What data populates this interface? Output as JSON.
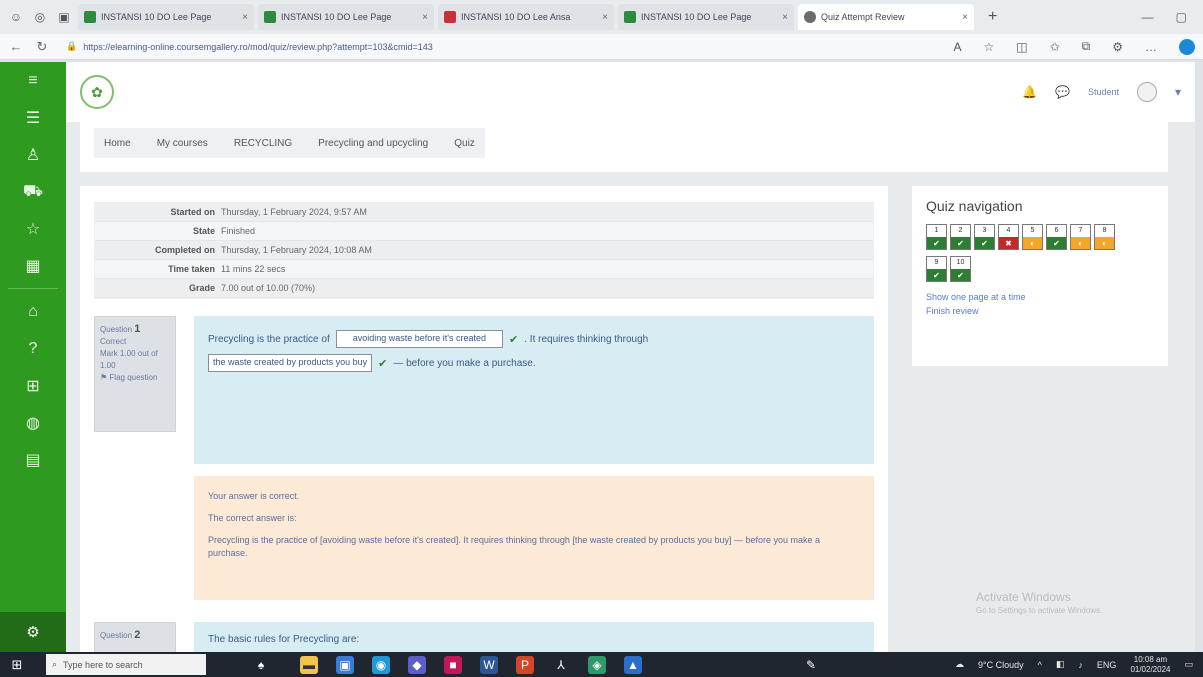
{
  "browser": {
    "tabs": [
      {
        "label": "INSTANSI 10 DO Lee Page",
        "active": false
      },
      {
        "label": "INSTANSI 10 DO Lee Page",
        "active": false
      },
      {
        "label": "INSTANSI 10 DO Lee Ansa",
        "active": false
      },
      {
        "label": "INSTANSI 10 DO Lee Page",
        "active": false
      },
      {
        "label": "Quiz Attempt Review",
        "active": true
      }
    ],
    "url": "https://elearning-online.coursemgallery.ro/mod/quiz/review.php?attempt=103&cmid=143"
  },
  "sidebar": {
    "items": [
      "menu-icon",
      "list-icon",
      "user-icon",
      "car-icon",
      "star-icon",
      "calendar-icon",
      "home-icon",
      "help-icon",
      "grid-icon",
      "globe-icon",
      "book-icon"
    ]
  },
  "header": {
    "logo_text": "Logo",
    "user_name": "Student"
  },
  "breadcrumb": [
    "Home",
    "My courses",
    "RECYCLING",
    "Precycling and upcycling",
    "Quiz"
  ],
  "summary": [
    {
      "key": "Started on",
      "value": "Thursday, 1 February 2024, 9:57 AM"
    },
    {
      "key": "State",
      "value": "Finished"
    },
    {
      "key": "Completed on",
      "value": "Thursday, 1 February 2024, 10:08 AM"
    },
    {
      "key": "Time taken",
      "value": "11 mins 22 secs"
    },
    {
      "key": "Grade",
      "value": "7.00 out of 10.00 (70%)"
    }
  ],
  "question1": {
    "label": "Question",
    "number": "1",
    "status": "Correct",
    "mark": "Mark 1.00 out of 1.00",
    "flag": "Flag question",
    "text_before": "Precycling is the practice of",
    "answer1": "avoiding waste before it's created",
    "text_middle": ". It requires thinking through",
    "answer2": "the waste created by products you buy",
    "text_after": "— before you make a purchase."
  },
  "feedback": {
    "line1": "Your answer is correct.",
    "line2": "The correct answer is:",
    "line3": "Precycling is the practice of [avoiding waste before it's created]. It requires thinking through [the waste created by products you buy] — before you make a purchase."
  },
  "question2": {
    "label": "Question",
    "number": "2",
    "text": "The basic rules for Precycling are:"
  },
  "quiznav": {
    "title": "Quiz navigation",
    "buttons": [
      {
        "n": "1",
        "state": "correct"
      },
      {
        "n": "2",
        "state": "correct"
      },
      {
        "n": "3",
        "state": "correct"
      },
      {
        "n": "4",
        "state": "incorrect"
      },
      {
        "n": "5",
        "state": "partial"
      },
      {
        "n": "6",
        "state": "correct"
      },
      {
        "n": "7",
        "state": "partial"
      },
      {
        "n": "8",
        "state": "partial"
      },
      {
        "n": "9",
        "state": "correct"
      },
      {
        "n": "10",
        "state": "correct"
      }
    ],
    "show_one_page": "Show one page at a time",
    "finish_review": "Finish review"
  },
  "watermark": {
    "title": "Activate Windows",
    "sub": "Go to Settings to activate Windows."
  },
  "taskbar": {
    "search_placeholder": "Type here to search",
    "weather": "9°C Cloudy",
    "lang": "ENG",
    "time": "10:08 am",
    "date": "01/02/2024"
  }
}
